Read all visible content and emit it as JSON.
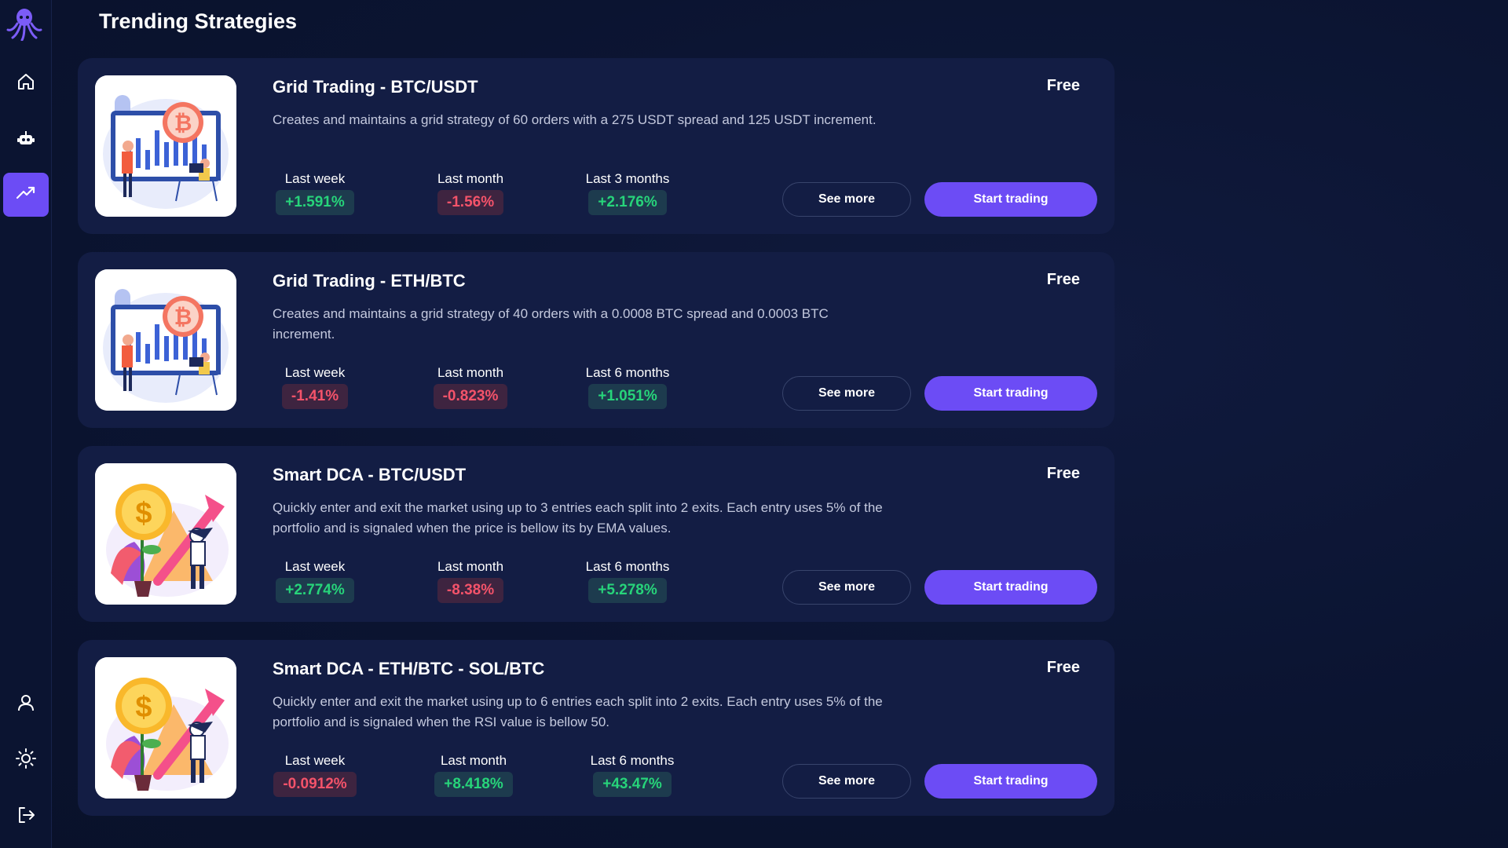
{
  "page": {
    "title": "Trending Strategies"
  },
  "sidebar": {
    "items": [
      {
        "icon": "home-icon"
      },
      {
        "icon": "robot-icon"
      },
      {
        "icon": "trending-up-icon",
        "active": true
      },
      {
        "icon": "user-icon"
      },
      {
        "icon": "sun-icon"
      },
      {
        "icon": "logout-icon"
      }
    ]
  },
  "strategies": [
    {
      "title": "Grid Trading - BTC/USDT",
      "description": "Creates and maintains a grid strategy of 60 orders with a 275 USDT spread and 125 USDT increment.",
      "price": "Free",
      "image": "bitcoin-chart-illustration",
      "stats": [
        {
          "label": "Last week",
          "value": "+1.591%",
          "trend": "pos"
        },
        {
          "label": "Last month",
          "value": "-1.56%",
          "trend": "neg"
        },
        {
          "label": "Last 3 months",
          "value": "+2.176%",
          "trend": "pos"
        }
      ],
      "see_more": "See more",
      "start": "Start trading"
    },
    {
      "title": "Grid Trading - ETH/BTC",
      "description": "Creates and maintains a grid strategy of 40 orders with a 0.0008 BTC spread and 0.0003 BTC increment.",
      "price": "Free",
      "image": "bitcoin-chart-illustration",
      "stats": [
        {
          "label": "Last week",
          "value": "-1.41%",
          "trend": "neg"
        },
        {
          "label": "Last month",
          "value": "-0.823%",
          "trend": "neg"
        },
        {
          "label": "Last 6 months",
          "value": "+1.051%",
          "trend": "pos"
        }
      ],
      "see_more": "See more",
      "start": "Start trading"
    },
    {
      "title": "Smart DCA - BTC/USDT",
      "description": "Quickly enter and exit the market using up to 3 entries each split into 2 exits. Each entry uses 5% of the portfolio and is signaled when the price is bellow its by EMA values.",
      "price": "Free",
      "image": "dollar-growth-illustration",
      "stats": [
        {
          "label": "Last week",
          "value": "+2.774%",
          "trend": "pos"
        },
        {
          "label": "Last month",
          "value": "-8.38%",
          "trend": "neg"
        },
        {
          "label": "Last 6 months",
          "value": "+5.278%",
          "trend": "pos"
        }
      ],
      "see_more": "See more",
      "start": "Start trading"
    },
    {
      "title": "Smart DCA - ETH/BTC - SOL/BTC",
      "description": "Quickly enter and exit the market using up to 6 entries each split into 2 exits. Each entry uses 5% of the portfolio and is signaled when the RSI value is bellow 50.",
      "price": "Free",
      "image": "dollar-growth-illustration",
      "stats": [
        {
          "label": "Last week",
          "value": "-0.0912%",
          "trend": "neg"
        },
        {
          "label": "Last month",
          "value": "+8.418%",
          "trend": "pos"
        },
        {
          "label": "Last 6 months",
          "value": "+43.47%",
          "trend": "pos"
        }
      ],
      "see_more": "See more",
      "start": "Start trading"
    }
  ],
  "colors": {
    "accent": "#6c4cf5",
    "positive": "#27d47a",
    "negative": "#f4536a",
    "card": "#131d44",
    "background": "#0b1431"
  }
}
